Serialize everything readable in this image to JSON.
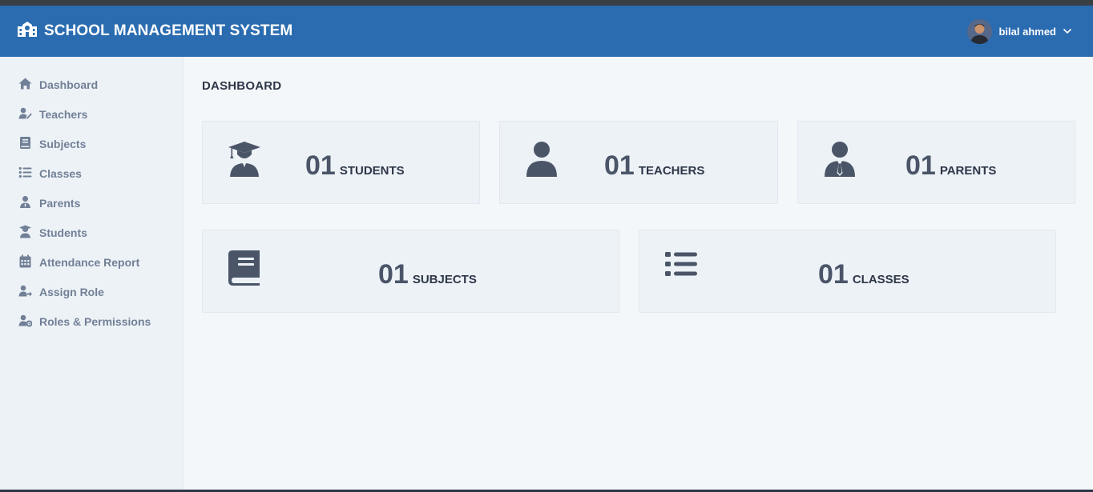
{
  "header": {
    "title": "SCHOOL MANAGEMENT SYSTEM",
    "user_name": "bilal ahmed"
  },
  "sidebar": {
    "items": [
      {
        "label": "Dashboard",
        "icon": "home-icon"
      },
      {
        "label": "Teachers",
        "icon": "teacher-icon"
      },
      {
        "label": "Subjects",
        "icon": "book-icon"
      },
      {
        "label": "Classes",
        "icon": "list-icon"
      },
      {
        "label": "Parents",
        "icon": "parent-icon"
      },
      {
        "label": "Students",
        "icon": "student-icon"
      },
      {
        "label": "Attendance Report",
        "icon": "calendar-icon"
      },
      {
        "label": "Assign Role",
        "icon": "user-arrow-icon"
      },
      {
        "label": "Roles & Permissions",
        "icon": "user-gear-icon"
      }
    ]
  },
  "main": {
    "page_title": "DASHBOARD",
    "cards": [
      {
        "count": "01",
        "label": "STUDENTS",
        "icon": "graduate-icon"
      },
      {
        "count": "01",
        "label": "TEACHERS",
        "icon": "user-icon"
      },
      {
        "count": "01",
        "label": "PARENTS",
        "icon": "user-tie-icon"
      },
      {
        "count": "01",
        "label": "SUBJECTS",
        "icon": "book-icon"
      },
      {
        "count": "01",
        "label": "CLASSES",
        "icon": "list-icon"
      }
    ]
  },
  "colors": {
    "navbar": "#2b6cb0",
    "sidebar_bg": "#edf2f7",
    "sidebar_text": "#718096",
    "card_bg": "#edf2f7",
    "card_icon": "#4a5568"
  }
}
